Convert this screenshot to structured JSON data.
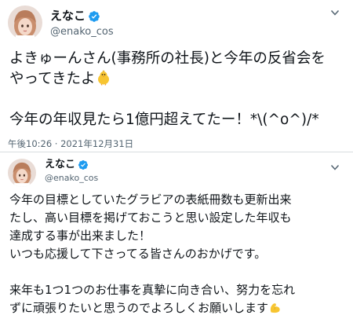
{
  "tweets": [
    {
      "display_name": "えなこ",
      "handle": "@enako_cos",
      "lines": [
        "よきゅーんさん(事務所の社長)と今年の反省会を",
        "やってきたよ",
        "",
        "今年の年収見たら1億円超えてたー！*\\(^o^)/*"
      ],
      "timestamp": "午後10:26 · 2021年12月31日",
      "emoji": "chick-emoji"
    },
    {
      "display_name": "えなこ",
      "handle": "@enako_cos",
      "lines": [
        "今年の目標としていたグラビアの表紙冊数も更新出来",
        "たし、高い目標を掲げておこうと思い設定した年収も",
        "達成する事が出来ました！",
        "いつも応援して下さってる皆さんのおかげです。",
        "",
        "来年も1つ1つのお仕事を真摯に向き合い、努力を忘れ",
        "ずに頑張りたいと思うのでよろしくお願いします"
      ],
      "emoji": "flexed-biceps-emoji"
    }
  ],
  "icons": {
    "verified": "verified-badge-icon",
    "more": "chevron-down-icon"
  },
  "colors": {
    "verified_blue": "#1d9bf0",
    "text": "#0f1419",
    "secondary": "#536471"
  }
}
